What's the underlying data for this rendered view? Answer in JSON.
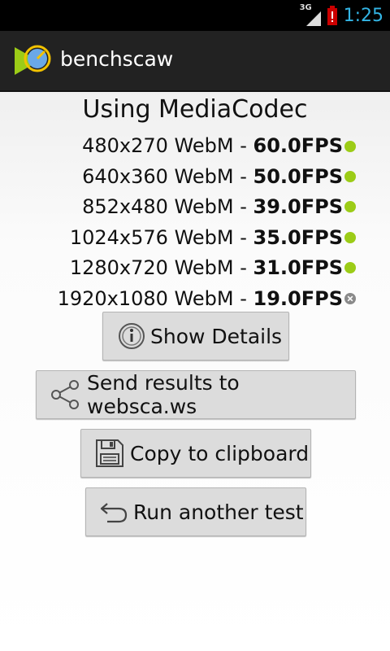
{
  "status": {
    "network": "3G",
    "time": "1:25"
  },
  "app": {
    "title": "benchscaw"
  },
  "heading": "Using MediaCodec",
  "results": [
    {
      "resolution": "480x270 WebM",
      "sep": " - ",
      "fps": "60.0FPS",
      "status": "ok"
    },
    {
      "resolution": "640x360 WebM",
      "sep": " - ",
      "fps": "50.0FPS",
      "status": "ok"
    },
    {
      "resolution": "852x480 WebM",
      "sep": " - ",
      "fps": "39.0FPS",
      "status": "ok"
    },
    {
      "resolution": "1024x576 WebM",
      "sep": " - ",
      "fps": "35.0FPS",
      "status": "ok"
    },
    {
      "resolution": "1280x720 WebM",
      "sep": " - ",
      "fps": "31.0FPS",
      "status": "ok"
    },
    {
      "resolution": "1920x1080 WebM",
      "sep": " - ",
      "fps": "19.0FPS",
      "status": "fail"
    }
  ],
  "buttons": {
    "details": "Show Details",
    "send": "Send results to websca.ws",
    "copy": "Copy to clipboard",
    "run": "Run another test"
  },
  "colors": {
    "ok": "#9ccc17",
    "fail": "#8a8a8a",
    "accent": "#33b5e5"
  }
}
